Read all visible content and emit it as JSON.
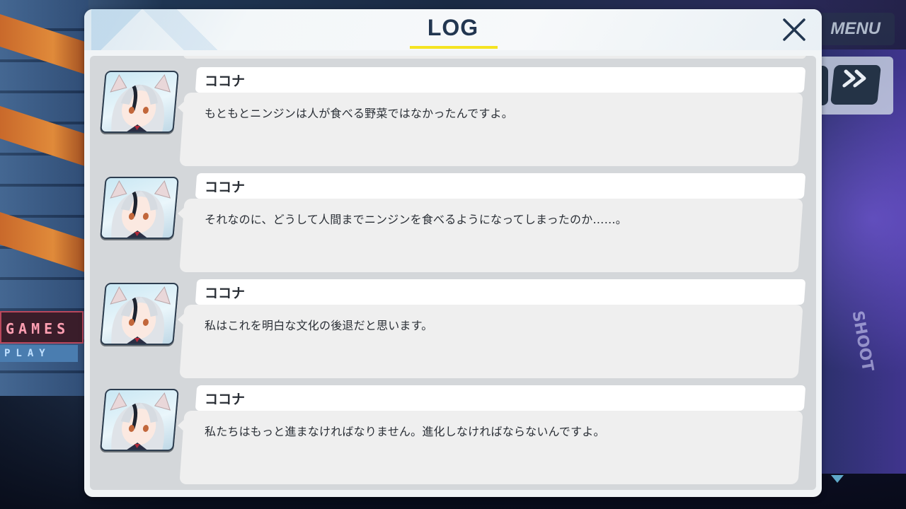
{
  "hud": {
    "menu_label": "MENU",
    "skip_icon": "double-chevron-right-icon"
  },
  "background": {
    "sign_top": "GAMES",
    "sign_bottom": "PLAY",
    "graffiti": "SHOOT"
  },
  "log": {
    "title": "LOG",
    "title_underline_color": "#f5e422",
    "close_icon": "close-x-icon",
    "entries": [
      {
        "speaker": "ココナ",
        "text": "もともとニンジンは人が食べる野菜ではなかったんですよ。"
      },
      {
        "speaker": "ココナ",
        "text": "それなのに、どうして人間までニンジンを食べるようになってしまったのか……。"
      },
      {
        "speaker": "ココナ",
        "text": "私はこれを明白な文化の後退だと思います。"
      },
      {
        "speaker": "ココナ",
        "text": "私たちはもっと進まなければなりません。進化しなければならないんですよ。"
      }
    ]
  },
  "colors": {
    "title": "#223650",
    "panel": "#f1f4f6",
    "speech_bg": "#efefef",
    "name_bg": "#ffffff"
  }
}
